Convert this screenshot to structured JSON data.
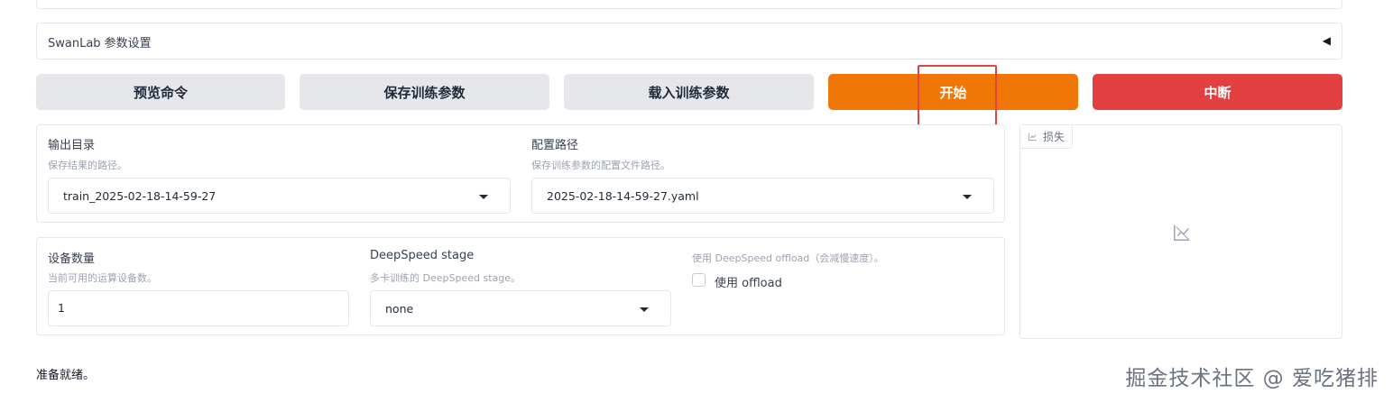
{
  "swanlab": {
    "label": "SwanLab 参数设置",
    "toggle_symbol": "◀"
  },
  "actions": {
    "preview": "预览命令",
    "save": "保存训练参数",
    "load": "载入训练参数",
    "start": "开始",
    "stop": "中断"
  },
  "output": {
    "output_dir": {
      "label": "输出目录",
      "info": "保存结果的路径。",
      "value": "train_2025-02-18-14-59-27"
    },
    "config_path": {
      "label": "配置路径",
      "info": "保存训练参数的配置文件路径。",
      "value": "2025-02-18-14-59-27.yaml"
    }
  },
  "devices": {
    "device_count": {
      "label": "设备数量",
      "info": "当前可用的运算设备数。",
      "value": "1"
    },
    "ds_stage": {
      "label": "DeepSpeed stage",
      "info": "多卡训练的 DeepSpeed stage。",
      "value": "none"
    },
    "ds_offload": {
      "info": "使用 DeepSpeed offload（会减慢速度）。",
      "label": "使用 offload",
      "checked": false
    }
  },
  "plot": {
    "tab_label": "损失",
    "icon": "chart-icon"
  },
  "status": "准备就绪。",
  "watermark": "掘金技术社区 @ 爱吃猪排",
  "colors": {
    "primary": "#f07706",
    "stop": "#e34141",
    "secondary": "#e5e7eb",
    "highlight": "#e0463f"
  }
}
